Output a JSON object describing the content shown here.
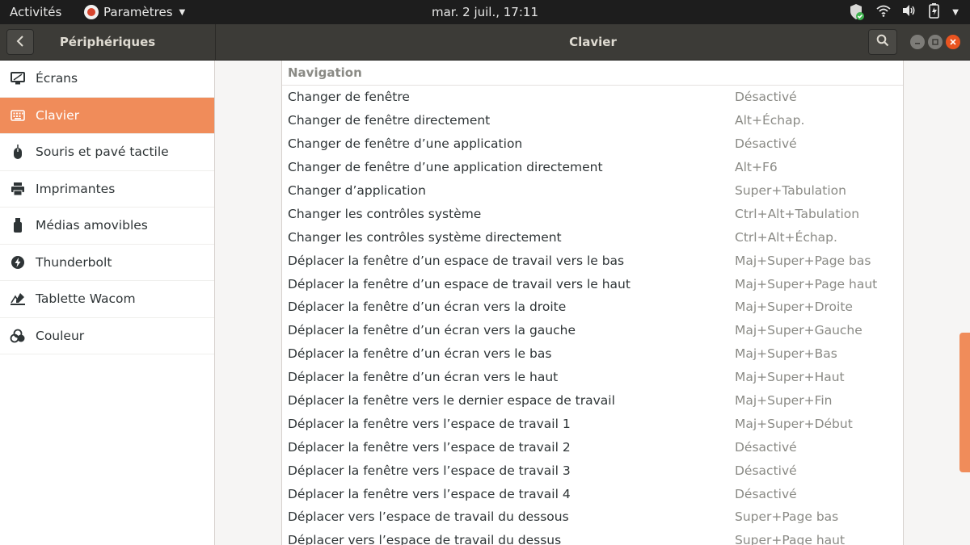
{
  "topbar": {
    "activities": "Activités",
    "app_menu": "Paramètres",
    "clock": "mar.  2 juil., 17:11"
  },
  "header": {
    "left_title": "Périphériques",
    "title": "Clavier"
  },
  "sidebar": {
    "items": [
      {
        "label": "Écrans",
        "icon": "display-icon",
        "active": false
      },
      {
        "label": "Clavier",
        "icon": "keyboard-icon",
        "active": true
      },
      {
        "label": "Souris et pavé tactile",
        "icon": "mouse-icon",
        "active": false
      },
      {
        "label": "Imprimantes",
        "icon": "printer-icon",
        "active": false
      },
      {
        "label": "Médias amovibles",
        "icon": "usb-drive-icon",
        "active": false
      },
      {
        "label": "Thunderbolt",
        "icon": "thunderbolt-icon",
        "active": false
      },
      {
        "label": "Tablette Wacom",
        "icon": "tablet-icon",
        "active": false
      },
      {
        "label": "Couleur",
        "icon": "color-icon",
        "active": false
      }
    ]
  },
  "shortcuts": {
    "section": "Navigation",
    "rows": [
      {
        "name": "Changer de fenêtre",
        "accel": "Désactivé"
      },
      {
        "name": "Changer de fenêtre directement",
        "accel": "Alt+Échap."
      },
      {
        "name": "Changer de fenêtre d’une application",
        "accel": "Désactivé"
      },
      {
        "name": "Changer de fenêtre d’une application directement",
        "accel": "Alt+F6"
      },
      {
        "name": "Changer d’application",
        "accel": "Super+Tabulation"
      },
      {
        "name": "Changer les contrôles système",
        "accel": "Ctrl+Alt+Tabulation"
      },
      {
        "name": "Changer les contrôles système directement",
        "accel": "Ctrl+Alt+Échap."
      },
      {
        "name": "Déplacer la fenêtre d’un espace de travail vers le bas",
        "accel": "Maj+Super+Page bas"
      },
      {
        "name": "Déplacer la fenêtre d’un espace de travail vers le haut",
        "accel": "Maj+Super+Page haut"
      },
      {
        "name": "Déplacer la fenêtre d’un écran vers la droite",
        "accel": "Maj+Super+Droite"
      },
      {
        "name": "Déplacer la fenêtre d’un écran vers la gauche",
        "accel": "Maj+Super+Gauche"
      },
      {
        "name": "Déplacer la fenêtre d’un écran vers le bas",
        "accel": "Maj+Super+Bas"
      },
      {
        "name": "Déplacer la fenêtre d’un écran vers le haut",
        "accel": "Maj+Super+Haut"
      },
      {
        "name": "Déplacer la fenêtre vers le dernier espace de travail",
        "accel": "Maj+Super+Fin"
      },
      {
        "name": "Déplacer la fenêtre vers l’espace de travail 1",
        "accel": "Maj+Super+Début"
      },
      {
        "name": "Déplacer la fenêtre vers l’espace de travail 2",
        "accel": "Désactivé"
      },
      {
        "name": "Déplacer la fenêtre vers l’espace de travail 3",
        "accel": "Désactivé"
      },
      {
        "name": "Déplacer la fenêtre vers l’espace de travail 4",
        "accel": "Désactivé"
      },
      {
        "name": "Déplacer vers l’espace de travail du dessous",
        "accel": "Super+Page bas"
      },
      {
        "name": "Déplacer vers l’espace de travail du dessus",
        "accel": "Super+Page haut"
      }
    ]
  },
  "colors": {
    "accent": "#f08c5a",
    "headerbar": "#3c3b37",
    "topbar": "#1d1d1d",
    "close": "#e95420"
  }
}
